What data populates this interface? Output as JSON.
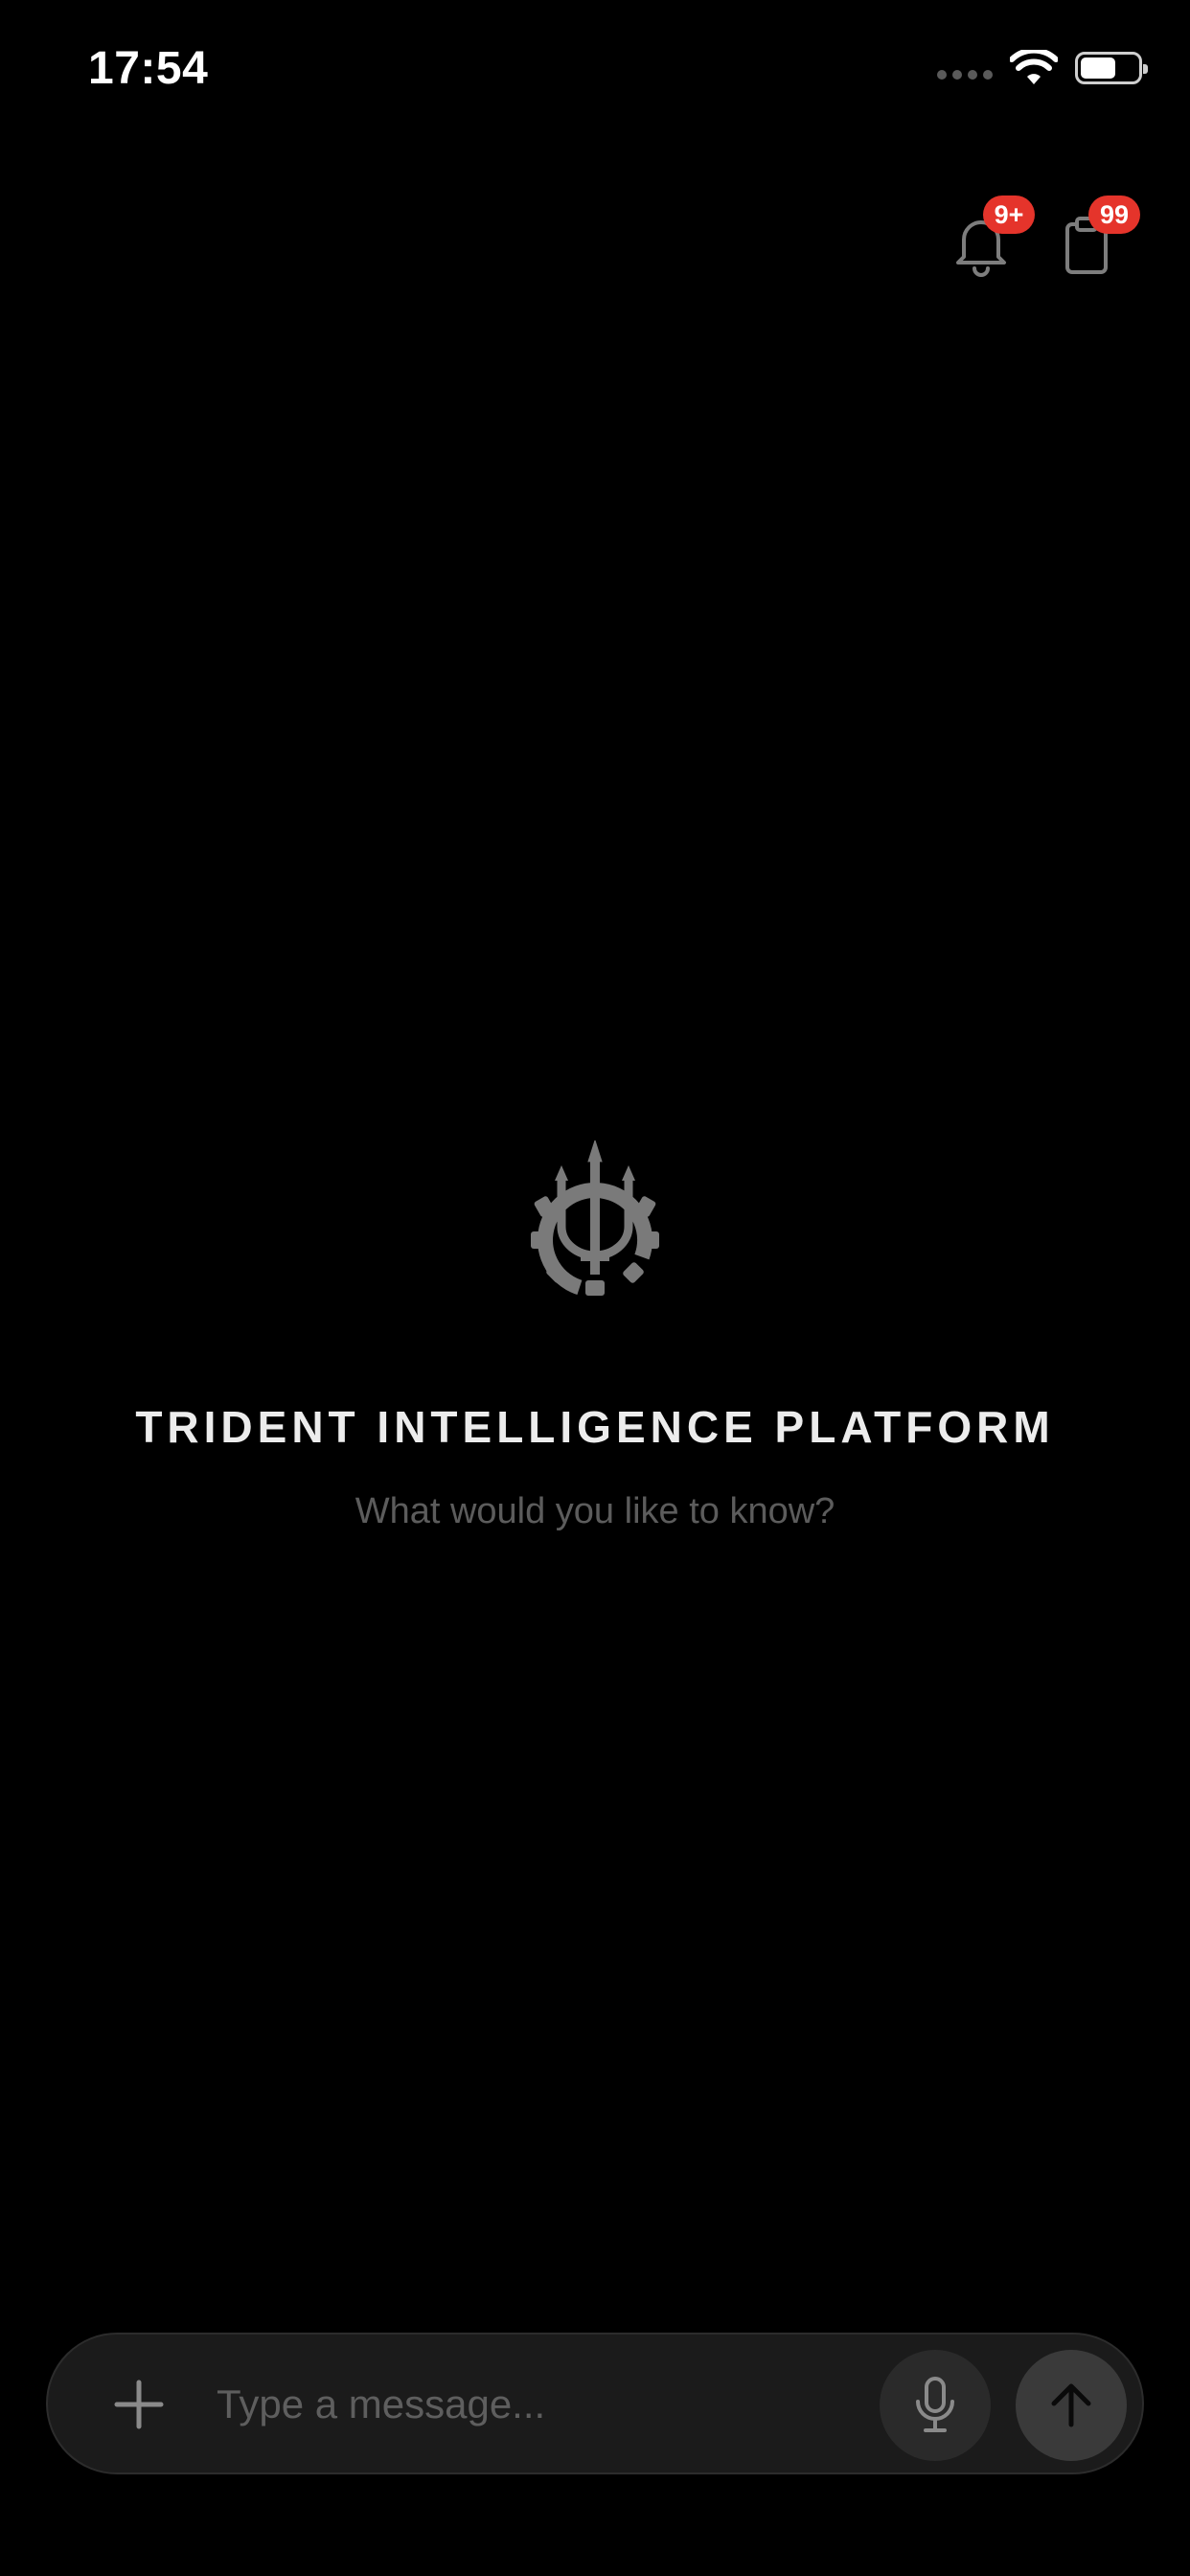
{
  "status_bar": {
    "time": "17:54",
    "icons": [
      "signal-icon",
      "wifi-icon",
      "battery-icon"
    ]
  },
  "header": {
    "notifications": {
      "icon": "bell-icon",
      "badge": "9+"
    },
    "clipboard": {
      "icon": "clipboard-icon",
      "badge": "99"
    }
  },
  "hero": {
    "logo_icon": "trident-gear-logo",
    "title": "TRIDENT INTELLIGENCE PLATFORM",
    "subtitle": "What would you like to know?"
  },
  "composer": {
    "add_icon": "plus-icon",
    "placeholder": "Type a message...",
    "value": "",
    "mic_icon": "microphone-icon",
    "send_icon": "arrow-up-icon"
  },
  "colors": {
    "background": "#000000",
    "badge": "#e5342b",
    "title": "#ececec",
    "subtitle": "#5c5c5c",
    "composer_bg": "#1b1b1b"
  }
}
